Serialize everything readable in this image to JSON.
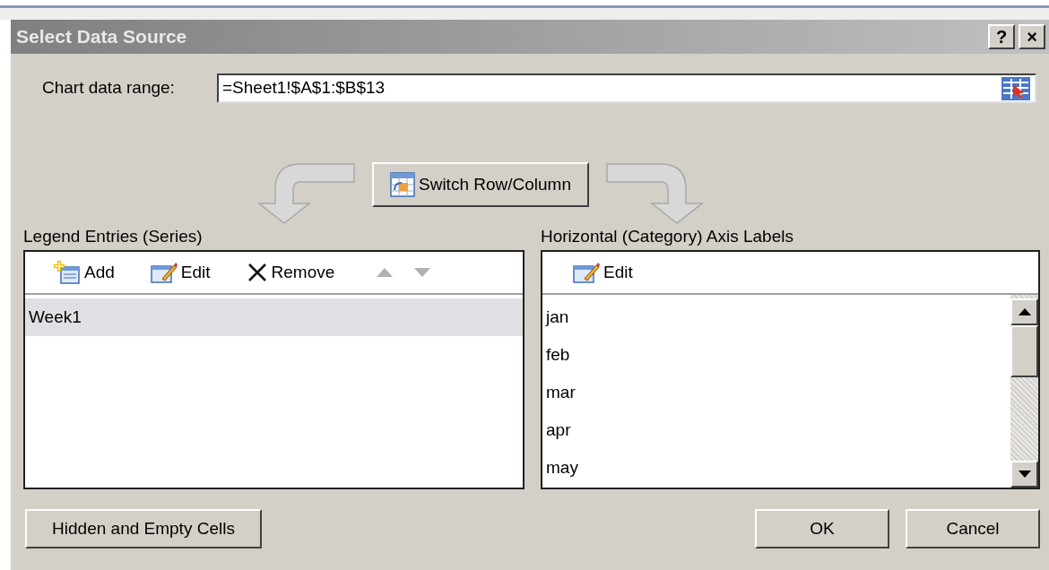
{
  "window": {
    "title": "Select Data Source",
    "title_buttons": [
      "?",
      "×"
    ]
  },
  "chart_data_range": {
    "label": "Chart data range:",
    "value": "=Sheet1!$A$1:$B$13"
  },
  "switch_button": "Switch Row/Column",
  "legend_entries": {
    "label": "Legend Entries (Series)",
    "toolbar": [
      {
        "kind": "add",
        "label": "Add",
        "disabled": false
      },
      {
        "kind": "edit",
        "label": "Edit",
        "disabled": false
      },
      {
        "kind": "remove",
        "label": "Remove",
        "disabled": false
      },
      {
        "kind": "up",
        "disabled": true
      },
      {
        "kind": "down",
        "disabled": true
      }
    ],
    "items": [
      {
        "label": "Week1",
        "selected": true
      }
    ]
  },
  "axis_labels": {
    "label": "Horizontal (Category) Axis Labels",
    "toolbar": [
      {
        "kind": "edit",
        "label": "Edit",
        "disabled": false
      }
    ],
    "items": [
      {
        "label": "jan"
      },
      {
        "label": "feb"
      },
      {
        "label": "mar"
      },
      {
        "label": "apr"
      },
      {
        "label": "may"
      }
    ]
  },
  "buttons": [
    {
      "kind": "hidden",
      "label": "Hidden and Empty Cells"
    },
    {
      "kind": "ok",
      "label": "OK"
    },
    {
      "kind": "cancel",
      "label": "Cancel"
    }
  ]
}
